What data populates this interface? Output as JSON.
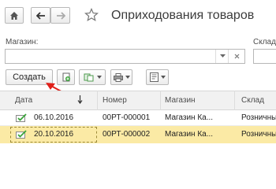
{
  "header": {
    "title": "Оприходования товаров",
    "nav": [
      "home-icon",
      "back-arrow-icon",
      "forward-arrow-icon",
      "favorite-star-icon"
    ]
  },
  "filters": {
    "store_label": "Магазин:",
    "store_value": "",
    "warehouse_label": "Склад"
  },
  "toolbar": {
    "create_label": "Создать"
  },
  "table": {
    "columns": [
      "Дата",
      "Номер",
      "Магазин",
      "Склад"
    ],
    "rows": [
      {
        "date": "06.10.2016",
        "number": "00РТ-000001",
        "store": "Магазин Ка...",
        "warehouse": "Розничный",
        "selected": false
      },
      {
        "date": "20.10.2016",
        "number": "00РТ-000002",
        "store": "Магазин Ка...",
        "warehouse": "Розничный",
        "selected": true
      }
    ]
  },
  "colors": {
    "selected_row": "#fbeaa5",
    "annotation_arrow": "#e0201a",
    "doc_icon_check": "#3aa53a"
  }
}
